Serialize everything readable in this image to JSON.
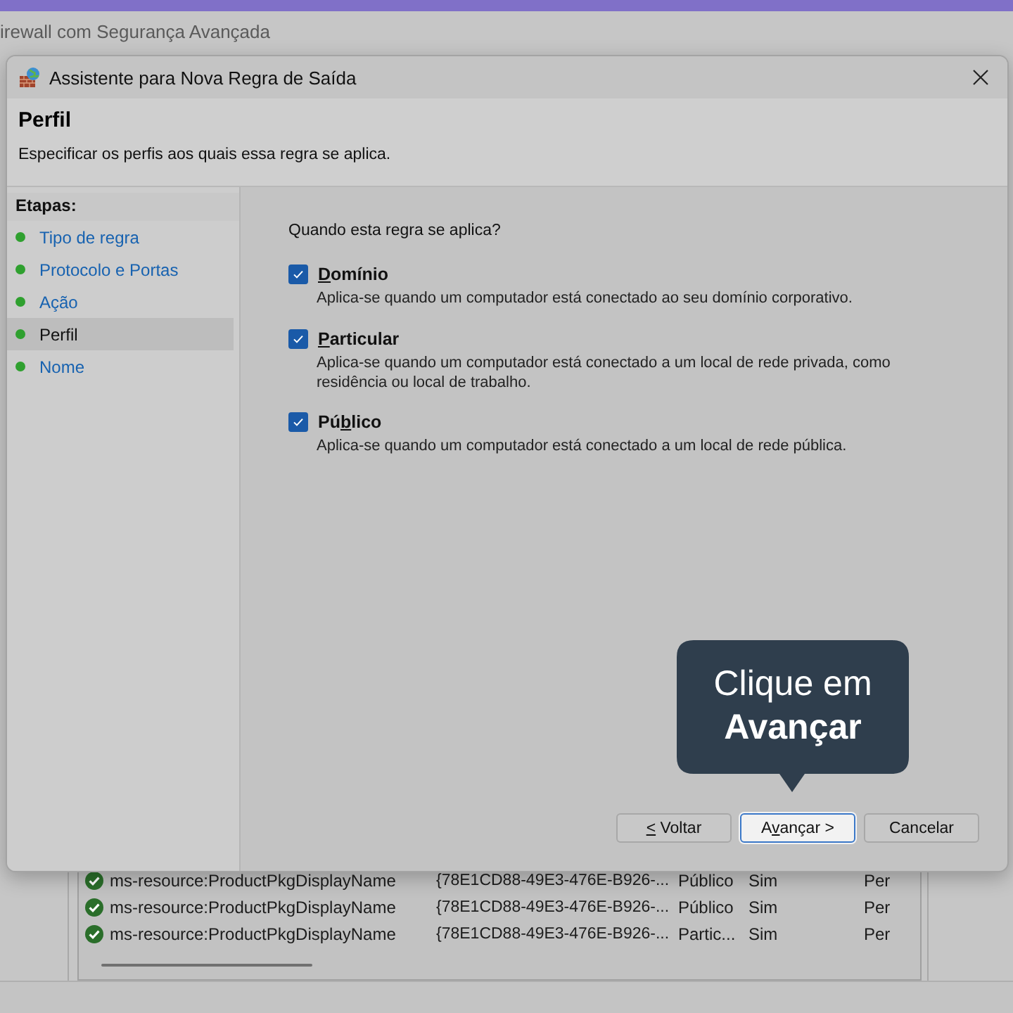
{
  "background_window": {
    "title": "irewall com Segurança Avançada",
    "rows": [
      {
        "name": "ms-resource:ProductPkgDisplayName",
        "group": "{78E1CD88-49E3-476E-B926-...",
        "profile": "Público",
        "enabled": "Sim",
        "action": "Per"
      },
      {
        "name": "ms-resource:ProductPkgDisplayName",
        "group": "{78E1CD88-49E3-476E-B926-...",
        "profile": "Público",
        "enabled": "Sim",
        "action": "Per"
      },
      {
        "name": "ms-resource:ProductPkgDisplayName",
        "group": "{78E1CD88-49E3-476E-B926-...",
        "profile": "Partic...",
        "enabled": "Sim",
        "action": "Per"
      }
    ]
  },
  "dialog": {
    "title": "Assistente para Nova Regra de Saída",
    "header": {
      "title": "Perfil",
      "subtitle": "Especificar os perfis aos quais essa regra se aplica."
    },
    "steps_heading": "Etapas:",
    "steps": [
      {
        "label": "Tipo de regra",
        "selected": false
      },
      {
        "label": "Protocolo e Portas",
        "selected": false
      },
      {
        "label": "Ação",
        "selected": false
      },
      {
        "label": "Perfil",
        "selected": true
      },
      {
        "label": "Nome",
        "selected": false
      }
    ],
    "question": "Quando esta regra se aplica?",
    "profiles": [
      {
        "label": {
          "key": "D",
          "post": "omínio"
        },
        "checked": true,
        "description": "Aplica-se quando um computador está conectado ao seu domínio corporativo."
      },
      {
        "label": {
          "key": "P",
          "post": "articular"
        },
        "checked": true,
        "description": "Aplica-se quando um computador está conectado a um local de rede privada, como residência ou local de trabalho."
      },
      {
        "label": {
          "pre": "Pú",
          "key": "b",
          "post": "lico"
        },
        "checked": true,
        "description": "Aplica-se quando um computador está conectado a um local de rede pública."
      }
    ],
    "buttons": [
      {
        "label": {
          "key": "<",
          "post": " Voltar"
        },
        "default": false
      },
      {
        "label": {
          "pre": "A",
          "key": "v",
          "post": "ançar >"
        },
        "default": true
      },
      {
        "label": {
          "post": "Cancelar"
        },
        "default": false
      }
    ]
  },
  "callout": {
    "text": "Clique em **Avançar**"
  }
}
